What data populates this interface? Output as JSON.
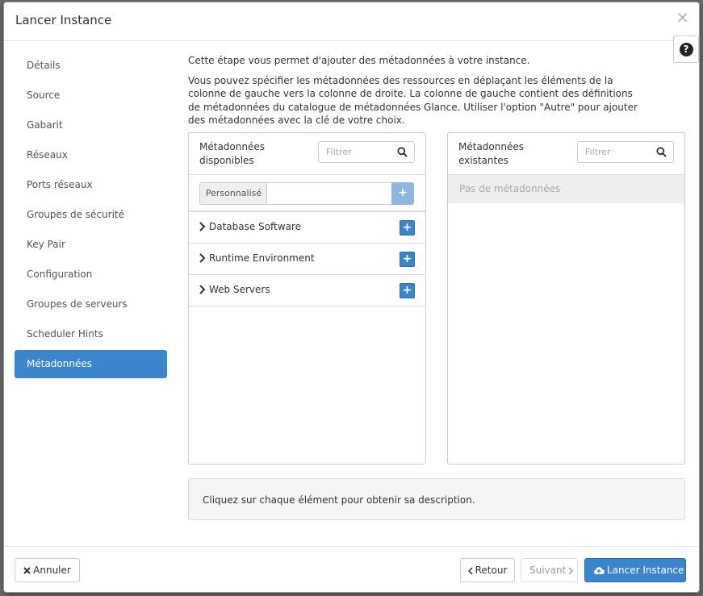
{
  "dialog": {
    "title": "Lancer Instance"
  },
  "nav": {
    "items": [
      {
        "label": "Détails"
      },
      {
        "label": "Source"
      },
      {
        "label": "Gabarit"
      },
      {
        "label": "Réseaux"
      },
      {
        "label": "Ports réseaux"
      },
      {
        "label": "Groupes de sécurité"
      },
      {
        "label": "Key Pair"
      },
      {
        "label": "Configuration"
      },
      {
        "label": "Groupes de serveurs"
      },
      {
        "label": "Scheduler Hints"
      },
      {
        "label": "Métadonnées",
        "active": true
      }
    ]
  },
  "intro": {
    "line1": "Cette étape vous permet d'ajouter des métadonnées à votre instance.",
    "line2": "Vous pouvez spécifier les métadonnées des ressources en déplaçant les éléments de la colonne de gauche vers la colonne de droite. La colonne de gauche contient des définitions de métadonnées du catalogue de métadonnées Glance. Utiliser l'option \"Autre\" pour ajouter des métadonnées avec la clé de votre choix."
  },
  "available": {
    "title_line1": "Métadonnées",
    "title_line2": "disponibles",
    "filter_placeholder": "Filtrer",
    "custom_label": "Personnalisé",
    "custom_add": "+",
    "groups": [
      {
        "label": "Database Software",
        "add": "+"
      },
      {
        "label": "Runtime Environment",
        "add": "+"
      },
      {
        "label": "Web Servers",
        "add": "+"
      }
    ]
  },
  "existing": {
    "title_line1": "Métadonnées",
    "title_line2": "existantes",
    "filter_placeholder": "Filtrer",
    "empty_text": "Pas de métadonnées"
  },
  "description": {
    "text": "Cliquez sur chaque élément pour obtenir sa description."
  },
  "footer": {
    "cancel_label": "Annuler",
    "back_label": "Retour",
    "next_label": "Suivant",
    "launch_label": "Lancer Instance"
  },
  "colors": {
    "accent": "#3a85cb",
    "overlay": "#6b6b6b"
  }
}
